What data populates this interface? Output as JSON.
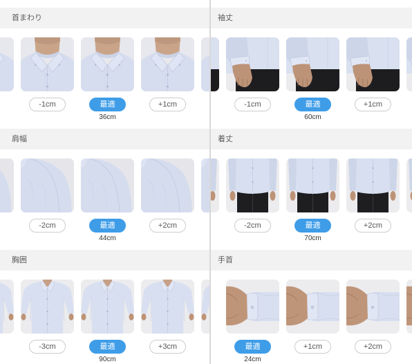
{
  "colors": {
    "accent": "#3f9de8",
    "header_background": "#f2f2f2",
    "divider": "#d8d8d8",
    "pill_border": "#cccccc",
    "text": "#555555",
    "thumbnail_background": "#ebebee"
  },
  "sections": {
    "neck": {
      "label": "首まわり",
      "illustration": "collar-photo",
      "options": [
        {
          "label": "-1cm",
          "selected": false
        },
        {
          "label": "最適",
          "selected": true
        },
        {
          "label": "+1cm",
          "selected": false
        }
      ],
      "fit_size": "36cm"
    },
    "shoulder": {
      "label": "肩幅",
      "illustration": "shoulder-photo",
      "options": [
        {
          "label": "-2cm",
          "selected": false
        },
        {
          "label": "最適",
          "selected": true
        },
        {
          "label": "+2cm",
          "selected": false
        }
      ],
      "fit_size": "44cm"
    },
    "chest": {
      "label": "胸囲",
      "illustration": "chest-photo",
      "options": [
        {
          "label": "-3cm",
          "selected": false
        },
        {
          "label": "最適",
          "selected": true
        },
        {
          "label": "+3cm",
          "selected": false
        }
      ],
      "fit_size": "90cm"
    },
    "sleeve": {
      "label": "袖丈",
      "illustration": "sleeve-photo",
      "options": [
        {
          "label": "-1cm",
          "selected": false
        },
        {
          "label": "最適",
          "selected": true
        },
        {
          "label": "+1cm",
          "selected": false
        }
      ],
      "fit_size": "60cm"
    },
    "length": {
      "label": "着丈",
      "illustration": "length-photo",
      "options": [
        {
          "label": "-2cm",
          "selected": false
        },
        {
          "label": "最適",
          "selected": true
        },
        {
          "label": "+2cm",
          "selected": false
        }
      ],
      "fit_size": "70cm"
    },
    "wrist": {
      "label": "手首",
      "illustration": "wrist-photo",
      "options": [
        {
          "label": "最適",
          "selected": true
        },
        {
          "label": "+1cm",
          "selected": false
        },
        {
          "label": "+2cm",
          "selected": false
        }
      ],
      "fit_size": "24cm"
    }
  }
}
